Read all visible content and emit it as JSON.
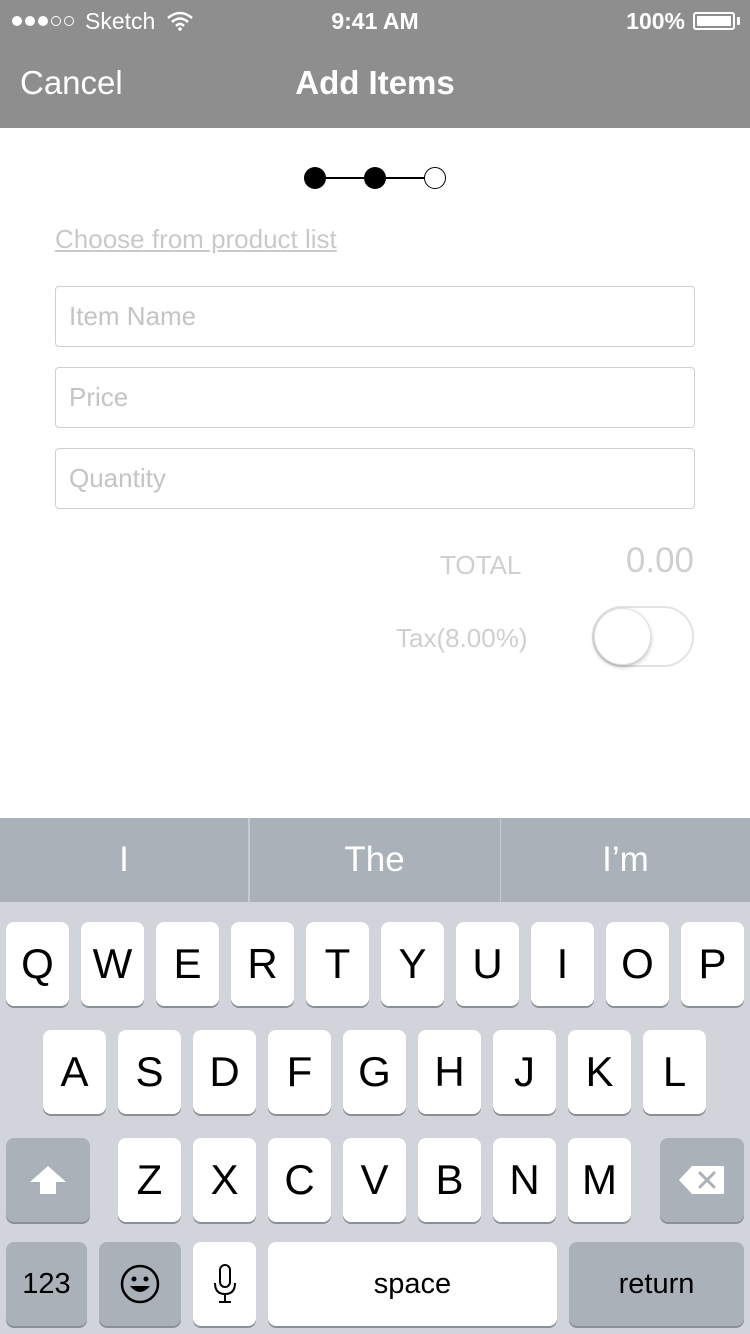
{
  "status_bar": {
    "carrier": "Sketch",
    "time": "9:41 AM",
    "battery": "100%"
  },
  "nav": {
    "cancel_label": "Cancel",
    "title": "Add Items"
  },
  "stepper": {
    "current_step": 2,
    "total_steps": 3
  },
  "form": {
    "product_link": "Choose from product list",
    "item_name_placeholder": "Item Name",
    "price_placeholder": "Price",
    "quantity_placeholder": "Quantity",
    "total_label": "TOTAL",
    "total_value": "0.00",
    "tax_label": "Tax(8.00%)",
    "tax_enabled": false
  },
  "keyboard": {
    "suggestions": [
      "I",
      "The",
      "I’m"
    ],
    "row1": [
      "Q",
      "W",
      "E",
      "R",
      "T",
      "Y",
      "U",
      "I",
      "O",
      "P"
    ],
    "row2": [
      "A",
      "S",
      "D",
      "F",
      "G",
      "H",
      "J",
      "K",
      "L"
    ],
    "row3": [
      "Z",
      "X",
      "C",
      "V",
      "B",
      "N",
      "M"
    ],
    "numbers_label": "123",
    "space_label": "space",
    "return_label": "return"
  },
  "colors": {
    "nav_background": "#8e8e8e",
    "keyboard_background": "#d1d5db",
    "suggestion_bar": "#abb1b9"
  }
}
